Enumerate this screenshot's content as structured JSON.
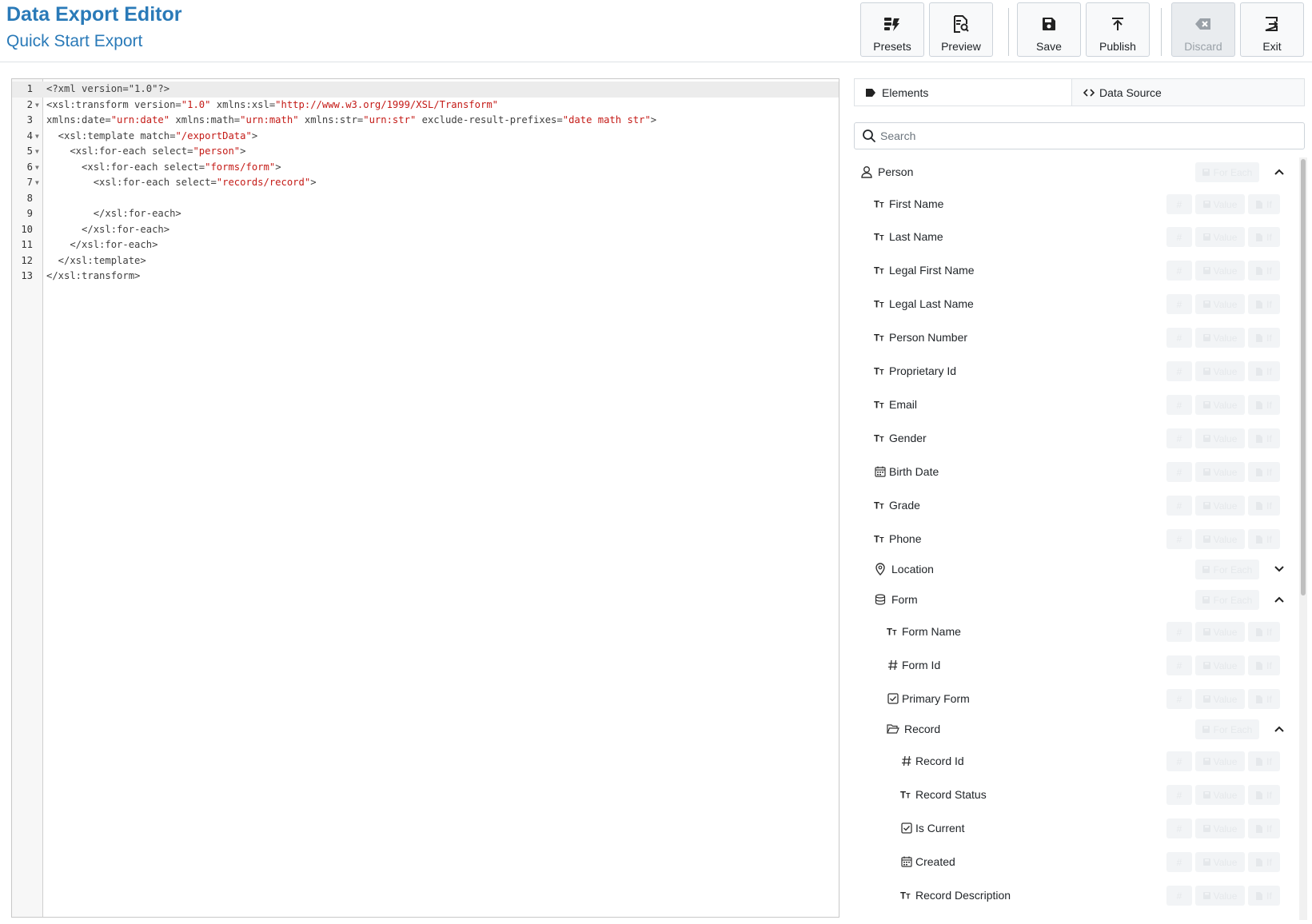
{
  "header": {
    "title": "Data Export Editor",
    "subtitle": "Quick Start Export"
  },
  "toolbar": [
    {
      "id": "presets",
      "label": "Presets",
      "icon": "presets-icon",
      "disabled": false
    },
    {
      "id": "preview",
      "label": "Preview",
      "icon": "preview-icon",
      "disabled": false
    },
    {
      "id": "save",
      "label": "Save",
      "icon": "save-icon",
      "disabled": false
    },
    {
      "id": "publish",
      "label": "Publish",
      "icon": "publish-icon",
      "disabled": false
    },
    {
      "id": "discard",
      "label": "Discard",
      "icon": "discard-icon",
      "disabled": true
    },
    {
      "id": "exit",
      "label": "Exit",
      "icon": "exit-icon",
      "disabled": false
    }
  ],
  "editor": {
    "lines": [
      {
        "n": "1",
        "fold": false,
        "html": "&lt;?xml version=\"1.0\"?&gt;"
      },
      {
        "n": "2",
        "fold": true,
        "html": "&lt;xsl:transform version=<span class='s'>\"1.0\"</span> xmlns:xsl=<span class='s'>\"http://www.w3.org/1999/XSL/Transform\"</span>"
      },
      {
        "n": "3",
        "fold": false,
        "html": "xmlns:date=<span class='s'>\"urn:date\"</span> xmlns:math=<span class='s'>\"urn:math\"</span> xmlns:str=<span class='s'>\"urn:str\"</span> exclude-result-prefixes=<span class='s'>\"date math str\"</span>&gt;"
      },
      {
        "n": "4",
        "fold": true,
        "html": "  &lt;xsl:template match=<span class='s'>\"/exportData\"</span>&gt;"
      },
      {
        "n": "5",
        "fold": true,
        "html": "    &lt;xsl:for-each select=<span class='s'>\"person\"</span>&gt;"
      },
      {
        "n": "6",
        "fold": true,
        "html": "      &lt;xsl:for-each select=<span class='s'>\"forms/form\"</span>&gt;"
      },
      {
        "n": "7",
        "fold": true,
        "html": "        &lt;xsl:for-each select=<span class='s'>\"records/record\"</span>&gt;"
      },
      {
        "n": "8",
        "fold": false,
        "html": ""
      },
      {
        "n": "9",
        "fold": false,
        "html": "        &lt;/xsl:for-each&gt;"
      },
      {
        "n": "10",
        "fold": false,
        "html": "      &lt;/xsl:for-each&gt;"
      },
      {
        "n": "11",
        "fold": false,
        "html": "    &lt;/xsl:for-each&gt;"
      },
      {
        "n": "12",
        "fold": false,
        "html": "  &lt;/xsl:template&gt;"
      },
      {
        "n": "13",
        "fold": false,
        "html": "&lt;/xsl:transform&gt;"
      }
    ]
  },
  "tabs": [
    {
      "label": "Elements",
      "icon": "tag-icon",
      "active": true
    },
    {
      "label": "Data Source",
      "icon": "code-icon",
      "active": false
    }
  ],
  "search": {
    "placeholder": "Search",
    "value": ""
  },
  "button_labels": {
    "hash": "#",
    "value": "Value",
    "if": "If",
    "for_each": "For Each"
  },
  "tree": [
    {
      "label": "Person",
      "icon": "user-icon",
      "level": 0,
      "type": "group",
      "expanded": true
    },
    {
      "label": "First Name",
      "icon": "text-type-icon",
      "level": 1,
      "type": "field"
    },
    {
      "label": "Last Name",
      "icon": "text-type-icon",
      "level": 1,
      "type": "field"
    },
    {
      "label": "Legal First Name",
      "icon": "text-type-icon",
      "level": 1,
      "type": "field"
    },
    {
      "label": "Legal Last Name",
      "icon": "text-type-icon",
      "level": 1,
      "type": "field"
    },
    {
      "label": "Person Number",
      "icon": "text-type-icon",
      "level": 1,
      "type": "field"
    },
    {
      "label": "Proprietary Id",
      "icon": "text-type-icon",
      "level": 1,
      "type": "field"
    },
    {
      "label": "Email",
      "icon": "text-type-icon",
      "level": 1,
      "type": "field"
    },
    {
      "label": "Gender",
      "icon": "text-type-icon",
      "level": 1,
      "type": "field"
    },
    {
      "label": "Birth Date",
      "icon": "calendar-icon",
      "level": 1,
      "type": "field"
    },
    {
      "label": "Grade",
      "icon": "text-type-icon",
      "level": 1,
      "type": "field"
    },
    {
      "label": "Phone",
      "icon": "text-type-icon",
      "level": 1,
      "type": "field"
    },
    {
      "label": "Location",
      "icon": "map-pin-icon",
      "level": 1,
      "type": "group",
      "expanded": false
    },
    {
      "label": "Form",
      "icon": "database-icon",
      "level": 1,
      "type": "group",
      "expanded": true
    },
    {
      "label": "Form Name",
      "icon": "text-type-icon",
      "level": 2,
      "type": "field"
    },
    {
      "label": "Form Id",
      "icon": "hash-icon",
      "level": 2,
      "type": "field"
    },
    {
      "label": "Primary Form",
      "icon": "checkbox-icon",
      "level": 2,
      "type": "field"
    },
    {
      "label": "Record",
      "icon": "folder-open-icon",
      "level": 2,
      "type": "group",
      "expanded": true
    },
    {
      "label": "Record Id",
      "icon": "hash-icon",
      "level": 3,
      "type": "field"
    },
    {
      "label": "Record Status",
      "icon": "text-type-icon",
      "level": 3,
      "type": "field"
    },
    {
      "label": "Is Current",
      "icon": "checkbox-icon",
      "level": 3,
      "type": "field"
    },
    {
      "label": "Created",
      "icon": "calendar-icon",
      "level": 3,
      "type": "field"
    },
    {
      "label": "Record Description",
      "icon": "text-type-icon",
      "level": 3,
      "type": "field"
    }
  ],
  "colors": {
    "brand": "#2a7ab8",
    "string": "#c41a16",
    "disabled_button": "#f2f4f6"
  }
}
